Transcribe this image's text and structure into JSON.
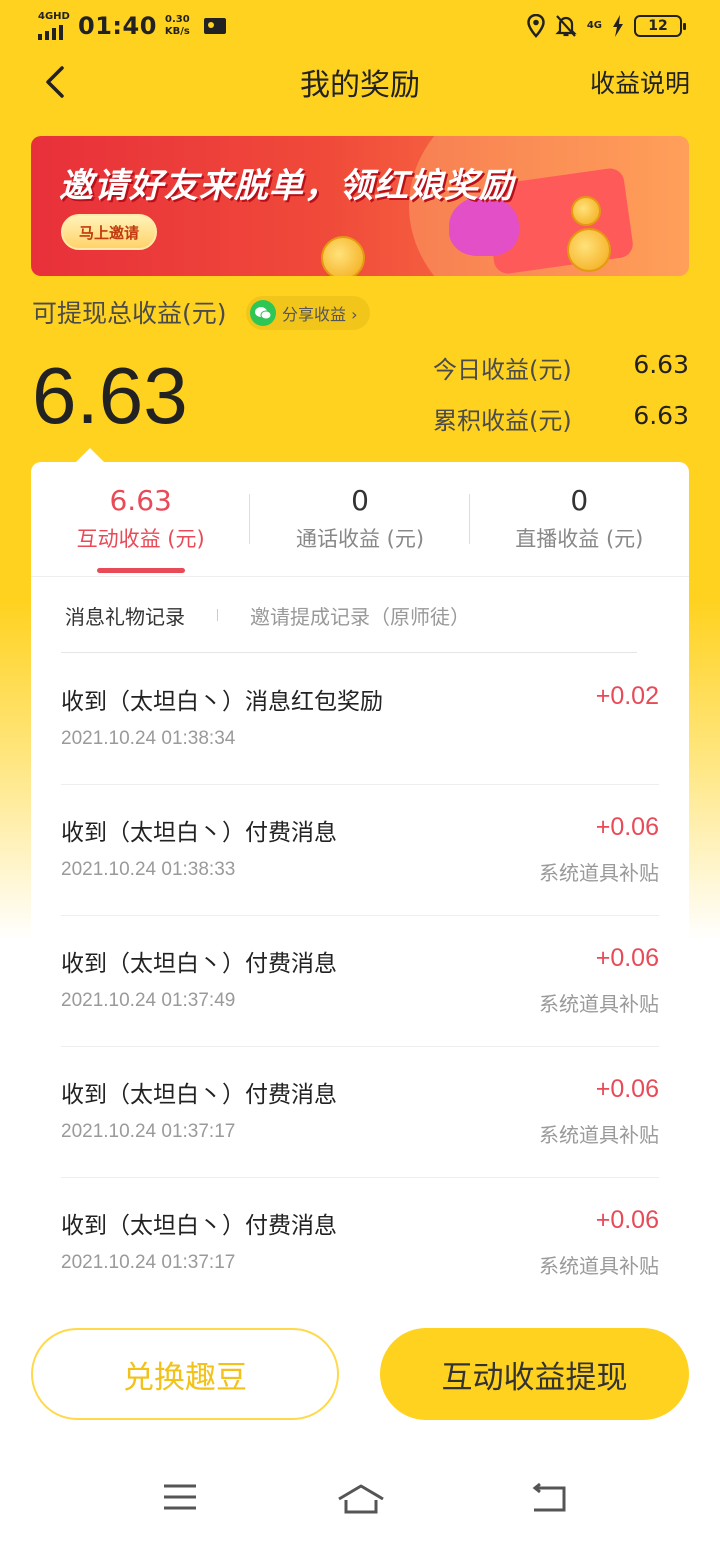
{
  "status_bar": {
    "network": "4GHD",
    "time": "01:40",
    "speed_value": "0.30",
    "speed_unit": "KB/s",
    "network_right": "4G",
    "battery": "12"
  },
  "nav": {
    "title": "我的奖励",
    "right_link": "收益说明"
  },
  "banner": {
    "title": "邀请好友来脱单，领红娘奖励",
    "button": "马上邀请"
  },
  "summary": {
    "total_label": "可提现总收益(元)",
    "share_label": "分享收益 ›",
    "total_amount": "6.63",
    "today_label": "今日收益(元)",
    "today_value": "6.63",
    "cumulative_label": "累积收益(元)",
    "cumulative_value": "6.63"
  },
  "tabs": [
    {
      "value": "6.63",
      "label": "互动收益 (元)"
    },
    {
      "value": "0",
      "label": "通话收益 (元)"
    },
    {
      "value": "0",
      "label": "直播收益 (元)"
    }
  ],
  "subtabs": {
    "gift_records": "消息礼物记录",
    "invite_records": "邀请提成记录（原师徒）"
  },
  "records": [
    {
      "title": "收到（太坦白丶）消息红包奖励",
      "time": "2021.10.24 01:38:34",
      "amount": "+0.02",
      "note": ""
    },
    {
      "title": "收到（太坦白丶）付费消息",
      "time": "2021.10.24 01:38:33",
      "amount": "+0.06",
      "note": "系统道具补贴"
    },
    {
      "title": "收到（太坦白丶）付费消息",
      "time": "2021.10.24 01:37:49",
      "amount": "+0.06",
      "note": "系统道具补贴"
    },
    {
      "title": "收到（太坦白丶）付费消息",
      "time": "2021.10.24 01:37:17",
      "amount": "+0.06",
      "note": "系统道具补贴"
    },
    {
      "title": "收到（太坦白丶）付费消息",
      "time": "2021.10.24 01:37:17",
      "amount": "+0.06",
      "note": "系统道具补贴"
    }
  ],
  "actions": {
    "exchange": "兑换趣豆",
    "withdraw": "互动收益提现"
  },
  "colors": {
    "brand_yellow": "#ffd21f",
    "accent_red": "#e84a57"
  }
}
